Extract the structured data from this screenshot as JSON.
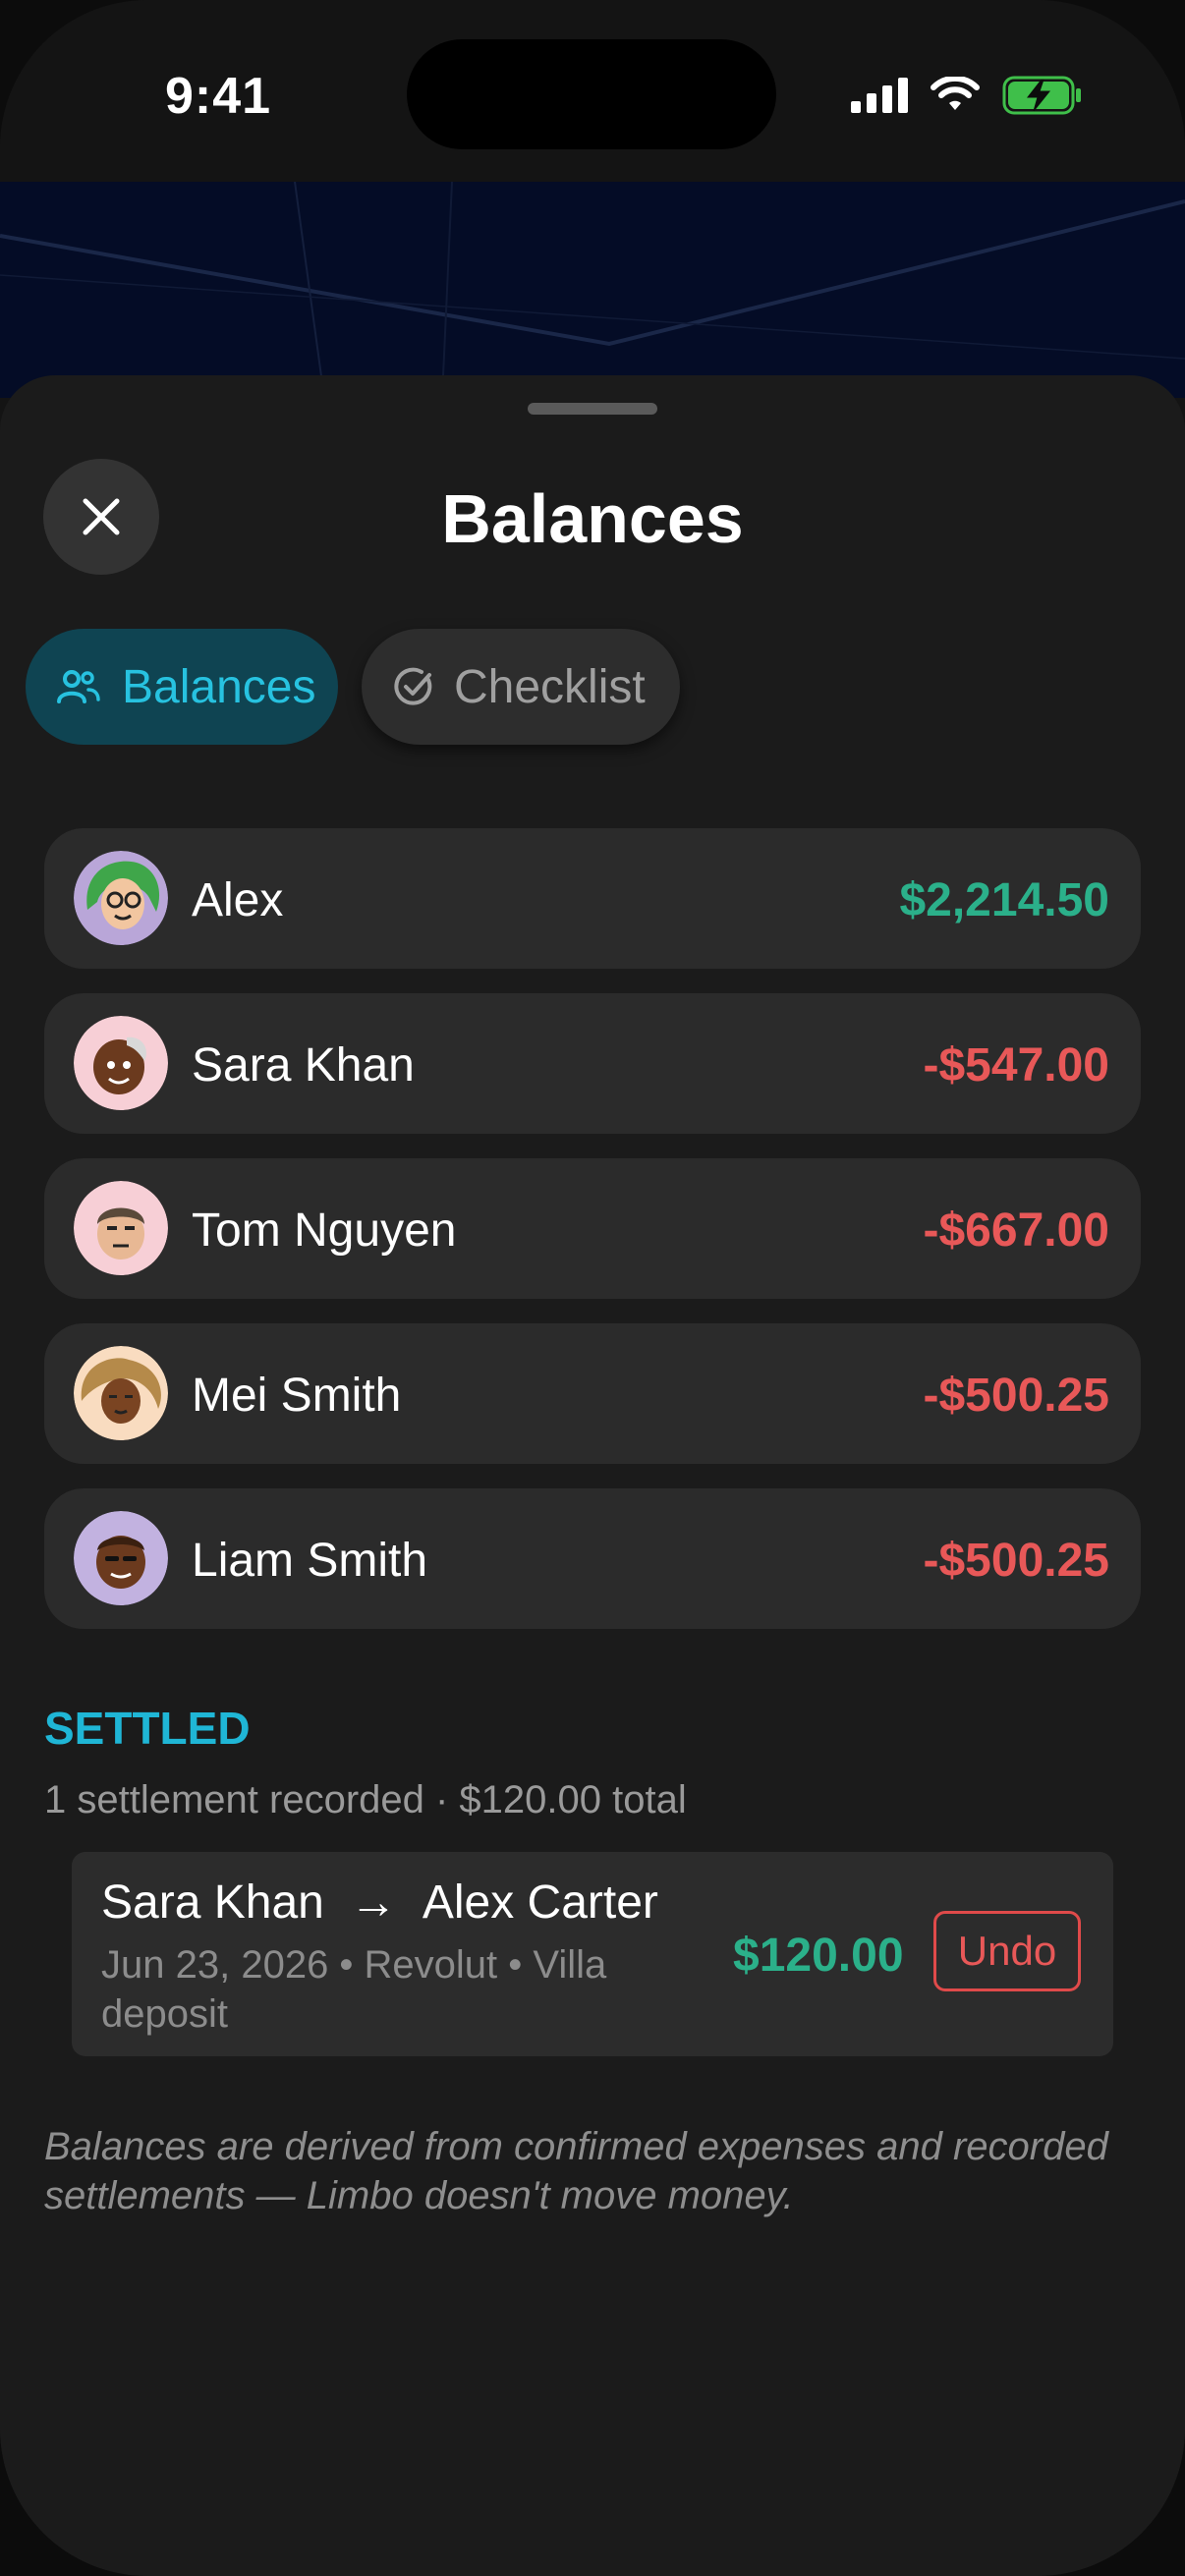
{
  "status_bar": {
    "time": "9:41"
  },
  "header": {
    "title": "Balances",
    "close_icon": "close-icon"
  },
  "tabs": [
    {
      "label": "Balances",
      "icon": "people-icon",
      "active": true
    },
    {
      "label": "Checklist",
      "icon": "check-circle-icon",
      "active": false
    }
  ],
  "balances": [
    {
      "name": "Alex",
      "amount": "$2,214.50",
      "status": "positive"
    },
    {
      "name": "Sara Khan",
      "amount": "-$547.00",
      "status": "negative"
    },
    {
      "name": "Tom Nguyen",
      "amount": "-$667.00",
      "status": "negative"
    },
    {
      "name": "Mei Smith",
      "amount": "-$500.25",
      "status": "negative"
    },
    {
      "name": "Liam Smith",
      "amount": "-$500.25",
      "status": "negative"
    }
  ],
  "settled": {
    "heading": "SETTLED",
    "summary": "1 settlement recorded · $120.00 total",
    "items": [
      {
        "from": "Sara Khan",
        "arrow": "→",
        "to": "Alex Carter",
        "meta": "Jun 23, 2026  •  Revolut  •  Villa deposit",
        "amount": "$120.00",
        "undo_label": "Undo"
      }
    ]
  },
  "footnote": "Balances are derived from confirmed expenses and recorded settlements — Limbo doesn't move money.",
  "colors": {
    "positive": "#2bb08a",
    "negative": "#e85858",
    "accent": "#27c2e0",
    "card": "#2b2b2b",
    "sheet": "#1b1b1b"
  }
}
